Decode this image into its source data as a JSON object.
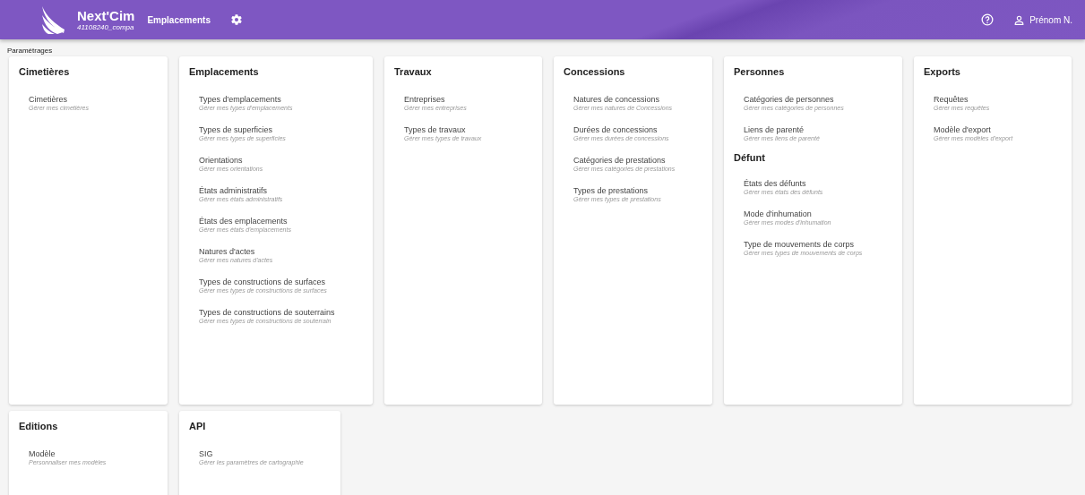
{
  "header": {
    "app_name": "Next'Cim",
    "account": "41108240_compa",
    "module": "Emplacements",
    "user": "Prénom N."
  },
  "breadcrumb": "Paramétrages",
  "rows": [
    [
      {
        "sections": [
          {
            "title": "Cimetières",
            "items": [
              {
                "label": "Cimetières",
                "description": "Gérer mes cimetières"
              }
            ]
          }
        ]
      },
      {
        "sections": [
          {
            "title": "Emplacements",
            "items": [
              {
                "label": "Types d'emplacements",
                "description": "Gérer mes types d'emplacements"
              },
              {
                "label": "Types de superficies",
                "description": "Gérer mes types de superficies"
              },
              {
                "label": "Orientations",
                "description": "Gérer mes orientations"
              },
              {
                "label": "États administratifs",
                "description": "Gérer mes états administratifs"
              },
              {
                "label": "États des emplacements",
                "description": "Gérer mes états d'emplacements"
              },
              {
                "label": "Natures d'actes",
                "description": "Gérer mes natures d'actes"
              },
              {
                "label": "Types de constructions de surfaces",
                "description": "Gérer mes types de constructions de surfaces"
              },
              {
                "label": "Types de constructions de souterrains",
                "description": "Gérer mes types de constructions de souterrain"
              }
            ]
          }
        ]
      },
      {
        "sections": [
          {
            "title": "Travaux",
            "items": [
              {
                "label": "Entreprises",
                "description": "Gérer mes entreprises"
              },
              {
                "label": "Types de travaux",
                "description": "Gérer mes types de travaux"
              }
            ]
          }
        ]
      },
      {
        "sections": [
          {
            "title": "Concessions",
            "items": [
              {
                "label": "Natures de concessions",
                "description": "Gérer mes natures de Concessions"
              },
              {
                "label": "Durées de concessions",
                "description": "Gérer mes durées de concessions"
              },
              {
                "label": "Catégories de prestations",
                "description": "Gérer mes catégories de prestations"
              },
              {
                "label": "Types de prestations",
                "description": "Gérer mes types de prestations"
              }
            ]
          }
        ]
      },
      {
        "sections": [
          {
            "title": "Personnes",
            "items": [
              {
                "label": "Catégories de personnes",
                "description": "Gérer mes catégories de personnes"
              },
              {
                "label": "Liens de parenté",
                "description": "Gérer mes liens de parenté"
              }
            ]
          },
          {
            "title": "Défunt",
            "items": [
              {
                "label": "États des défunts",
                "description": "Gérer mes états des défunts"
              },
              {
                "label": "Mode d'inhumation",
                "description": "Gérer mes modes d'inhumation"
              },
              {
                "label": "Type de mouvements de corps",
                "description": "Gérer mes types de mouvements de corps"
              }
            ]
          }
        ]
      },
      {
        "sections": [
          {
            "title": "Exports",
            "items": [
              {
                "label": "Requêtes",
                "description": "Gérer mes requêtes"
              },
              {
                "label": "Modèle d'export",
                "description": "Gérer mes modèles d'export"
              }
            ]
          }
        ]
      }
    ],
    [
      {
        "sections": [
          {
            "title": "Editions",
            "items": [
              {
                "label": "Modèle",
                "description": "Personnaliser mes modèles"
              }
            ]
          }
        ]
      },
      {
        "sections": [
          {
            "title": "API",
            "items": [
              {
                "label": "SIG",
                "description": "Gérer les paramètres de cartographie"
              }
            ]
          }
        ]
      }
    ]
  ]
}
